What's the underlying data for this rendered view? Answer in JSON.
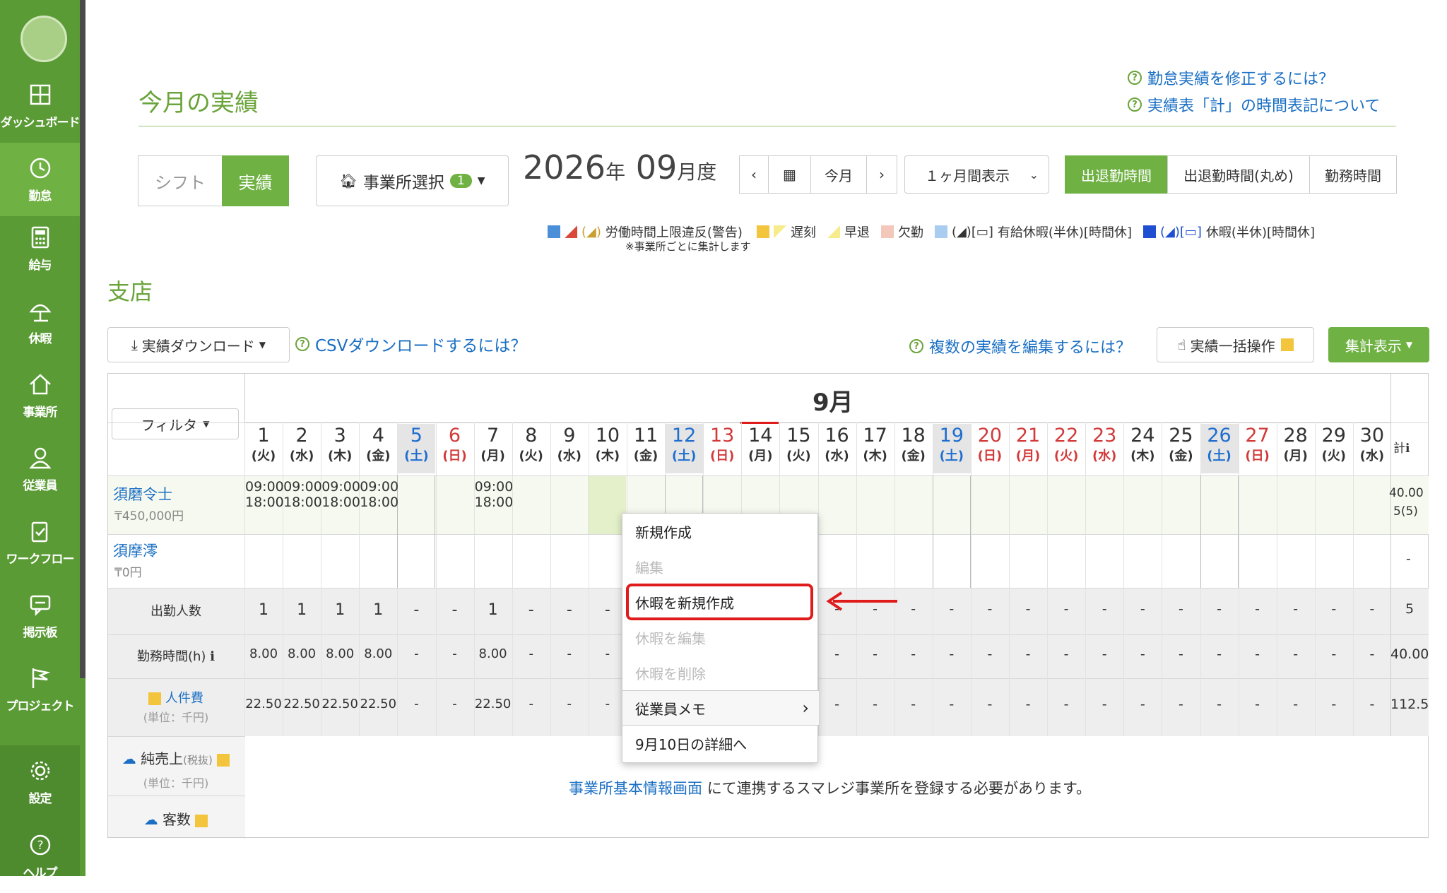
{
  "sidebar": {
    "items": [
      {
        "label": "ダッシュボード",
        "icon": "dashboard-icon"
      },
      {
        "label": "勤怠",
        "icon": "clock-icon"
      },
      {
        "label": "給与",
        "icon": "calculator-icon"
      },
      {
        "label": "休暇",
        "icon": "umbrella-icon"
      },
      {
        "label": "事業所",
        "icon": "home-icon"
      },
      {
        "label": "従業員",
        "icon": "user-icon"
      },
      {
        "label": "ワークフロー",
        "icon": "clipboard-icon"
      },
      {
        "label": "掲示板",
        "icon": "chat-icon"
      },
      {
        "label": "プロジェクト",
        "icon": "flag-icon"
      },
      {
        "label": "設定",
        "icon": "gear-icon"
      },
      {
        "label": "ヘルプ",
        "icon": "help-icon"
      }
    ],
    "active_index": 1
  },
  "header": {
    "title": "今月の実績",
    "help1": "勤怠実績を修正するには？",
    "help2": "実績表「計」の時間表記について"
  },
  "controls": {
    "shift_tab": "シフト",
    "actual_tab": "実績",
    "office_select": "事業所選択",
    "office_count": "1",
    "year": "2026",
    "year_unit": "年",
    "month": "09",
    "month_unit": "月度",
    "prev": "‹",
    "next": "›",
    "today": "今月",
    "range_select": "１ヶ月間表示",
    "view_tabs": [
      "出退勤時間",
      "出退勤時間(丸め)",
      "勤務時間"
    ]
  },
  "legend": {
    "items": [
      "労働時間上限違反(警告)",
      "遅刻",
      "早退",
      "欠勤",
      "有給休暇(半休)[時間休]",
      "休暇(半休)[時間休]"
    ],
    "note": "※事業所ごとに集計します"
  },
  "store": {
    "name": "支店",
    "download": "実績ダウンロード",
    "csv_help": "CSVダウンロードするには？",
    "multi_help": "複数の実績を編集するには？",
    "bulk": "実績一括操作",
    "summary": "集計表示"
  },
  "table": {
    "month_label": "9月",
    "filter": "フィルタ",
    "total_label": "計",
    "days": [
      {
        "d": "1",
        "w": "(火)",
        "t": ""
      },
      {
        "d": "2",
        "w": "(水)",
        "t": ""
      },
      {
        "d": "3",
        "w": "(木)",
        "t": ""
      },
      {
        "d": "4",
        "w": "(金)",
        "t": ""
      },
      {
        "d": "5",
        "w": "(土)",
        "t": "sat"
      },
      {
        "d": "6",
        "w": "(日)",
        "t": "sun"
      },
      {
        "d": "7",
        "w": "(月)",
        "t": ""
      },
      {
        "d": "8",
        "w": "(火)",
        "t": ""
      },
      {
        "d": "9",
        "w": "(水)",
        "t": ""
      },
      {
        "d": "10",
        "w": "(木)",
        "t": ""
      },
      {
        "d": "11",
        "w": "(金)",
        "t": ""
      },
      {
        "d": "12",
        "w": "(土)",
        "t": "sat"
      },
      {
        "d": "13",
        "w": "(日)",
        "t": "sun"
      },
      {
        "d": "14",
        "w": "(月)",
        "t": ""
      },
      {
        "d": "15",
        "w": "(火)",
        "t": ""
      },
      {
        "d": "16",
        "w": "(水)",
        "t": ""
      },
      {
        "d": "17",
        "w": "(木)",
        "t": ""
      },
      {
        "d": "18",
        "w": "(金)",
        "t": ""
      },
      {
        "d": "19",
        "w": "(土)",
        "t": "sat"
      },
      {
        "d": "20",
        "w": "(日)",
        "t": "sun"
      },
      {
        "d": "21",
        "w": "(月)",
        "t": "hol"
      },
      {
        "d": "22",
        "w": "(火)",
        "t": "hol"
      },
      {
        "d": "23",
        "w": "(水)",
        "t": "hol"
      },
      {
        "d": "24",
        "w": "(木)",
        "t": ""
      },
      {
        "d": "25",
        "w": "(金)",
        "t": ""
      },
      {
        "d": "26",
        "w": "(土)",
        "t": "sat"
      },
      {
        "d": "27",
        "w": "(日)",
        "t": "sun"
      },
      {
        "d": "28",
        "w": "(月)",
        "t": ""
      },
      {
        "d": "29",
        "w": "(火)",
        "t": ""
      },
      {
        "d": "30",
        "w": "(水)",
        "t": ""
      }
    ],
    "employees": [
      {
        "name": "須磨令士",
        "salary": "450,000円",
        "total1": "40.00",
        "total2": "5(5)",
        "shifts": [
          {
            "day": 0,
            "in": "09:00",
            "out": "18:00"
          },
          {
            "day": 1,
            "in": "09:00",
            "out": "18:00"
          },
          {
            "day": 2,
            "in": "09:00",
            "out": "18:00"
          },
          {
            "day": 3,
            "in": "09:00",
            "out": "18:00"
          },
          {
            "day": 6,
            "in": "09:00",
            "out": "18:00"
          }
        ]
      },
      {
        "name": "須摩澪",
        "salary": "0円",
        "total1": "-",
        "total2": ""
      }
    ],
    "summary_rows": [
      {
        "label": "出勤人数",
        "values": [
          "1",
          "1",
          "1",
          "1",
          "-",
          "-",
          "1",
          "-",
          "-",
          "-"
        ],
        "right": [
          "-",
          "-",
          "-",
          "-",
          "-",
          "-",
          "-",
          "-",
          "-",
          "-",
          "-",
          "-",
          "-",
          "-",
          "-"
        ],
        "total": "5"
      },
      {
        "label": "勤務時間(h)",
        "values": [
          "8.00",
          "8.00",
          "8.00",
          "8.00",
          "-",
          "-",
          "8.00",
          "-",
          "-",
          "-"
        ],
        "right": [
          "-",
          "-",
          "-",
          "-",
          "-",
          "-",
          "-",
          "-",
          "-",
          "-",
          "-",
          "-",
          "-",
          "-",
          "-"
        ],
        "total": "40.00"
      },
      {
        "label": "人件費",
        "sub": "(単位：千円)",
        "values": [
          "22.50",
          "22.50",
          "22.50",
          "22.50",
          "-",
          "-",
          "22.50",
          "-",
          "-",
          "-"
        ],
        "right": [
          "-",
          "-",
          "-",
          "-",
          "-",
          "-",
          "-",
          "-",
          "-",
          "-",
          "-",
          "-",
          "-",
          "-",
          "-"
        ],
        "total": "112.5"
      }
    ],
    "sales_label": "純売上",
    "sales_tax": "(税抜)",
    "sales_unit": "(単位：千円)",
    "customers_label": "客数",
    "notice_link": "事業所基本情報画面",
    "notice_text": "にて連携するスマレジ事業所を登録する必要があります。"
  },
  "context_menu": {
    "items": [
      {
        "label": "新規作成",
        "disabled": false
      },
      {
        "label": "編集",
        "disabled": true
      },
      {
        "label": "休暇を新規作成",
        "disabled": false
      },
      {
        "label": "休暇を編集",
        "disabled": true
      },
      {
        "label": "休暇を削除",
        "disabled": true
      },
      {
        "label": "従業員メモ",
        "disabled": false
      },
      {
        "label": "9月10日の詳細へ",
        "disabled": false
      }
    ]
  },
  "colors": {
    "brand": "#5a9b35",
    "accent": "#6fb143",
    "link": "#1a6fc4",
    "saturday": "#1f6ecf",
    "sunday": "#d23a3a",
    "highlight": "#e01b1b"
  }
}
